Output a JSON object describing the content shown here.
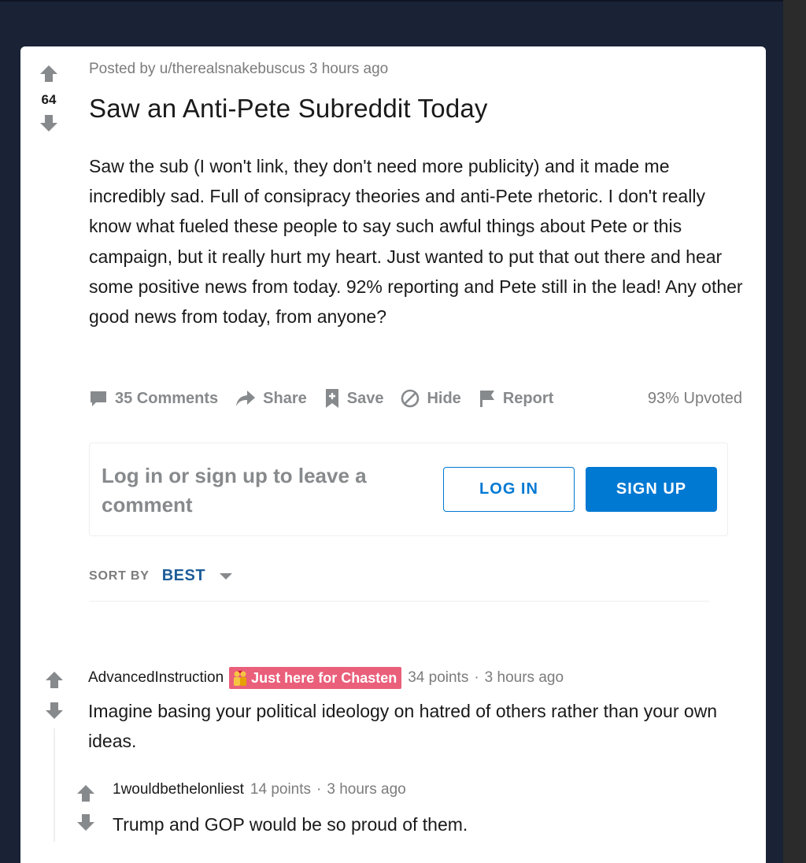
{
  "post": {
    "score": "64",
    "meta": "Posted by u/therealsnakebuscus 3 hours ago",
    "title": "Saw an Anti-Pete Subreddit Today",
    "body": "Saw the sub (I won't link, they don't need more publicity) and it made me incredibly sad. Full of consipracy theories and anti-Pete rhetoric. I don't really know what fueled these people to say such awful things about Pete or this campaign, but it really hurt my heart. Just wanted to put that out there and hear some positive news from today. 92% reporting and Pete still in the lead! Any other good news from today, from anyone?",
    "actions": {
      "comments": "35 Comments",
      "share": "Share",
      "save": "Save",
      "hide": "Hide",
      "report": "Report"
    },
    "upvoted": "93% Upvoted"
  },
  "login_prompt": {
    "text": "Log in or sign up to leave a comment",
    "login_label": "LOG IN",
    "signup_label": "SIGN UP"
  },
  "sort": {
    "label": "SORT BY",
    "value": "BEST"
  },
  "comments": [
    {
      "author": "AdvancedInstruction",
      "flair": "Just here for Chasten",
      "points": "34 points",
      "sep": "·",
      "time": "3 hours ago",
      "text": "Imagine basing your political ideology on hatred of others rather than your own ideas."
    },
    {
      "author": "1wouldbethelonliest",
      "points": "14 points",
      "sep": "·",
      "time": "3 hours ago",
      "text": "Trump and GOP would be so proud of them."
    }
  ],
  "colors": {
    "page_bg": "#1a2235",
    "accent": "#0079d3",
    "flair_bg": "#ea5f7a",
    "muted": "#878a8c"
  }
}
